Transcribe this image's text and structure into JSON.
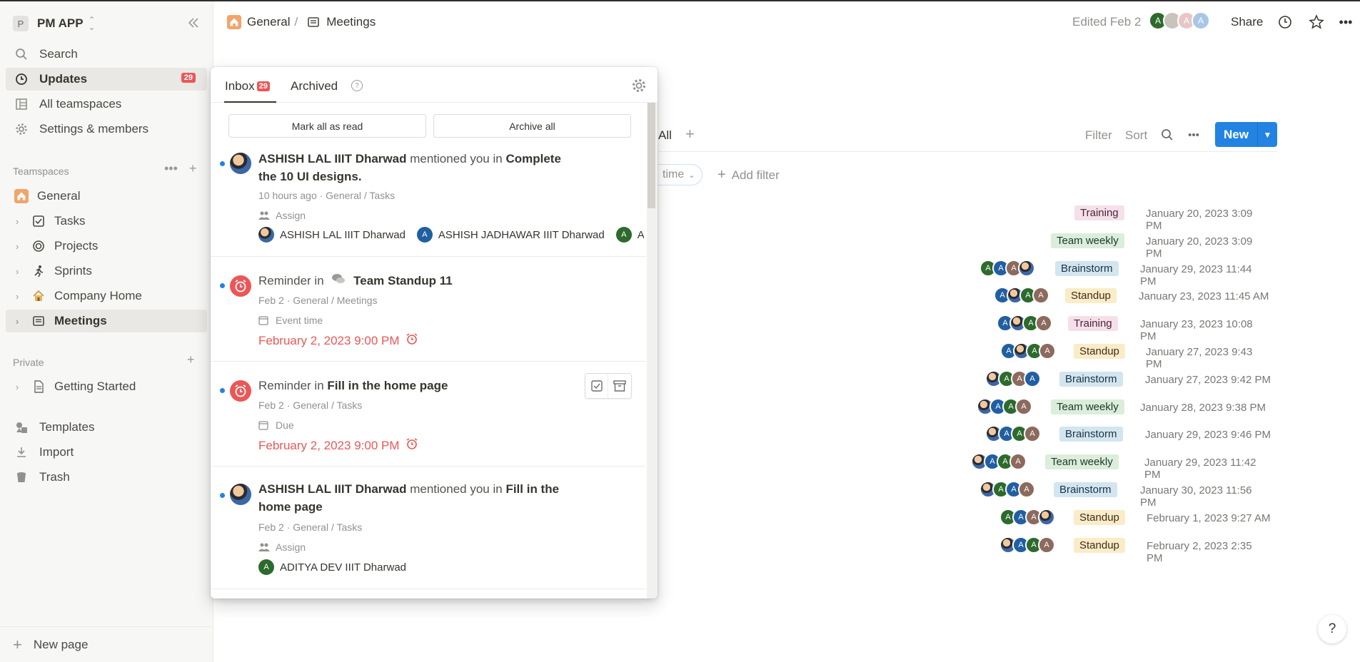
{
  "app": {
    "workspace_initial": "P",
    "workspace_name": "PM APP"
  },
  "sidebar": {
    "search": "Search",
    "updates": "Updates",
    "updates_badge": "29",
    "all_teamspaces": "All teamspaces",
    "settings": "Settings & members",
    "teamspaces_label": "Teamspaces",
    "teamspace_items": [
      {
        "label": "General"
      },
      {
        "label": "Tasks"
      },
      {
        "label": "Projects"
      },
      {
        "label": "Sprints"
      },
      {
        "label": "Company Home"
      },
      {
        "label": "Meetings"
      }
    ],
    "private_label": "Private",
    "private_items": [
      {
        "label": "Getting Started"
      }
    ],
    "templates": "Templates",
    "import": "Import",
    "trash": "Trash",
    "new_page": "New page"
  },
  "topbar": {
    "crumb_1": "General",
    "crumb_sep": "/",
    "crumb_2": "Meetings",
    "edited": "Edited Feb 2",
    "avatar_letter": "A",
    "share": "Share"
  },
  "database": {
    "view_all": "All",
    "filter": "Filter",
    "sort": "Sort",
    "new": "New",
    "filter_chip": "time",
    "add_filter": "Add filter",
    "rows": [
      {
        "tag": "Training",
        "date": "January 20, 2023 3:09 PM"
      },
      {
        "tag": "Team weekly",
        "date": "January 20, 2023 3:09 PM"
      },
      {
        "tag": "Brainstorm",
        "date": "January 29, 2023 11:44 PM"
      },
      {
        "tag": "Standup",
        "date": "January 23, 2023 11:45 AM"
      },
      {
        "tag": "Training",
        "date": "January 23, 2023 10:08 PM"
      },
      {
        "tag": "Standup",
        "date": "January 27, 2023 9:43 PM"
      },
      {
        "tag": "Brainstorm",
        "date": "January 27, 2023 9:42 PM"
      },
      {
        "tag": "Team weekly",
        "date": "January 28, 2023 9:38 PM"
      },
      {
        "tag": "Brainstorm",
        "date": "January 29, 2023 9:46 PM"
      },
      {
        "tag": "Team weekly",
        "date": "January 29, 2023 11:42 PM"
      },
      {
        "tag": "Brainstorm",
        "date": "January 30, 2023 11:56 PM"
      },
      {
        "tag": "Standup",
        "date": "February 1, 2023 9:27 AM"
      },
      {
        "tag": "Standup",
        "date": "February 2, 2023 2:35 PM"
      }
    ]
  },
  "inbox": {
    "tab_inbox": "Inbox",
    "tab_inbox_badge": "29",
    "tab_archived": "Archived",
    "help_glyph": "?",
    "mark_all_read": "Mark all as read",
    "archive_all": "Archive all",
    "notifications": [
      {
        "actor": "ASHISH LAL IIIT Dharwad",
        "verb": "mentioned you in",
        "target_line1": "Complete",
        "target_line2": "the 10 UI designs.",
        "meta": "10 hours ago · General / Tasks",
        "field": "Assign",
        "people": [
          "ASHISH LAL IIIT Dharwad",
          "ASHISH JADHAWAR IIIT Dharwad",
          "ADIT"
        ]
      },
      {
        "prefix": "Reminder in",
        "target": "Team Standup 11",
        "meta": "Feb 2 · General / Meetings",
        "field": "Event time",
        "date": "February 2, 2023 9:00 PM"
      },
      {
        "prefix": "Reminder in",
        "target": "Fill in the home page",
        "meta": "Feb 2 · General / Tasks",
        "field": "Due",
        "date": "February 2, 2023 9:00 PM"
      },
      {
        "actor": "ASHISH LAL IIIT Dharwad",
        "verb": "mentioned you in",
        "target_line1": "Fill in the",
        "target_line2": "home page",
        "meta": "Feb 2 · General / Tasks",
        "field": "Assign",
        "people": [
          "ADITYA DEV IIIT Dharwad"
        ]
      }
    ]
  },
  "help": "?"
}
